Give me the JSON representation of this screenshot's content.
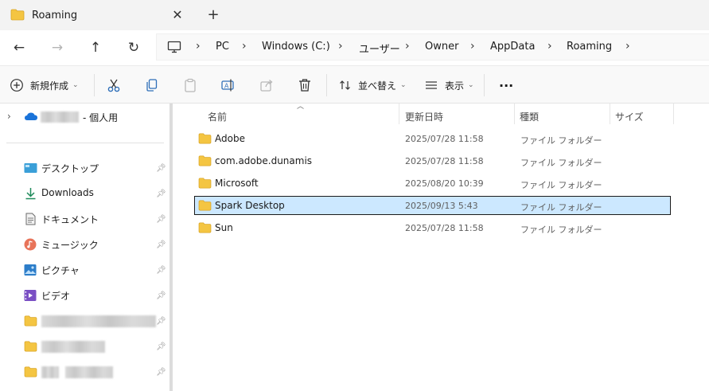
{
  "tab": {
    "title": "Roaming",
    "close": "✕",
    "new_tab": "+"
  },
  "nav": {
    "back": "←",
    "forward": "→",
    "up": "↑",
    "refresh": "↻"
  },
  "breadcrumb": {
    "items": [
      "PC",
      "Windows (C:)",
      "ユーザー",
      "Owner",
      "AppData",
      "Roaming"
    ],
    "separator": "›"
  },
  "toolbar": {
    "new_label": "新規作成",
    "sort_label": "並べ替え",
    "view_label": "表示",
    "more": "···",
    "icons": [
      "cut-icon",
      "copy-icon",
      "paste-icon",
      "rename-icon",
      "share-icon",
      "delete-icon"
    ]
  },
  "sidebar": {
    "onedrive_suffix": "- 個人用",
    "items": [
      {
        "label": "デスクトップ",
        "icon": "desktop-icon"
      },
      {
        "label": "Downloads",
        "icon": "downloads-icon"
      },
      {
        "label": "ドキュメント",
        "icon": "documents-icon"
      },
      {
        "label": "ミュージック",
        "icon": "music-icon"
      },
      {
        "label": "ピクチャ",
        "icon": "pictures-icon"
      },
      {
        "label": "ビデオ",
        "icon": "videos-icon"
      }
    ]
  },
  "columns": {
    "name": "名前",
    "date": "更新日時",
    "type": "種類",
    "size": "サイズ"
  },
  "files": [
    {
      "name": "Adobe",
      "date": "2025/07/28 11:58",
      "type": "ファイル フォルダー",
      "selected": false
    },
    {
      "name": "com.adobe.dunamis",
      "date": "2025/07/28 11:58",
      "type": "ファイル フォルダー",
      "selected": false
    },
    {
      "name": "Microsoft",
      "date": "2025/08/20 10:39",
      "type": "ファイル フォルダー",
      "selected": false
    },
    {
      "name": "Spark Desktop",
      "date": "2025/09/13 5:43",
      "type": "ファイル フォルダー",
      "selected": true
    },
    {
      "name": "Sun",
      "date": "2025/07/28 11:58",
      "type": "ファイル フォルダー",
      "selected": false
    }
  ],
  "colors": {
    "folder": "#f4c542",
    "selection": "#cce8ff",
    "onedrive": "#1a73d9"
  }
}
